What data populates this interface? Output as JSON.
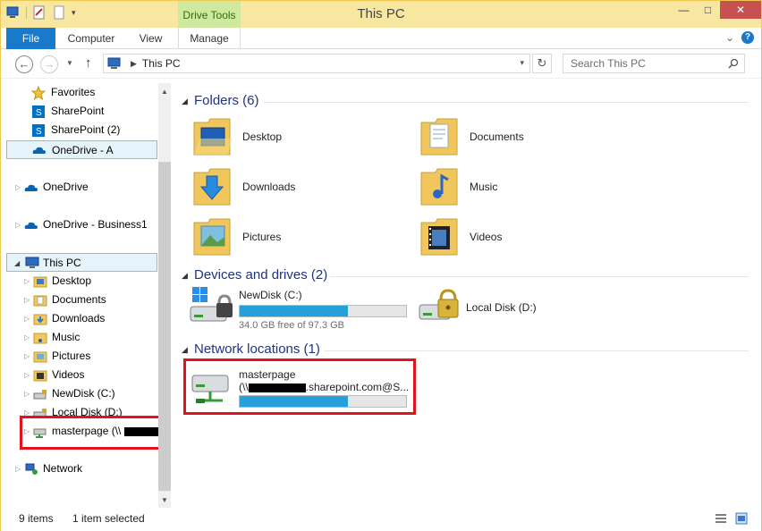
{
  "window": {
    "title": "This PC",
    "context_tab_label": "Drive Tools",
    "buttons": {
      "minimize": "—",
      "maximize": "□",
      "close": "✕"
    }
  },
  "ribbon": {
    "tabs": [
      {
        "label": "File"
      },
      {
        "label": "Computer"
      },
      {
        "label": "View"
      },
      {
        "label": "Manage"
      }
    ],
    "help_label": "?",
    "collapse_glyph": "⌄"
  },
  "address_bar": {
    "path": "This PC",
    "search_placeholder": "Search This PC",
    "back_glyph": "←",
    "forward_glyph": "→",
    "up_glyph": "↑",
    "refresh_glyph": "↻"
  },
  "nav_pane": {
    "items": [
      {
        "label": "Favorites",
        "icon": "star-icon"
      },
      {
        "label": "SharePoint",
        "icon": "sharepoint-icon"
      },
      {
        "label": "SharePoint (2)",
        "icon": "sharepoint-icon"
      },
      {
        "label": "OneDrive - A",
        "icon": "onedrive-icon"
      },
      {
        "label": "OneDrive",
        "icon": "onedrive-icon"
      },
      {
        "label": "OneDrive - Business1",
        "icon": "onedrive-icon"
      },
      {
        "label": "This PC",
        "icon": "computer-icon"
      },
      {
        "label": "Desktop",
        "icon": "folder-icon"
      },
      {
        "label": "Documents",
        "icon": "folder-icon"
      },
      {
        "label": "Downloads",
        "icon": "folder-icon"
      },
      {
        "label": "Music",
        "icon": "folder-icon"
      },
      {
        "label": "Pictures",
        "icon": "folder-icon"
      },
      {
        "label": "Videos",
        "icon": "folder-icon"
      },
      {
        "label": "NewDisk (C:)",
        "icon": "drive-icon"
      },
      {
        "label": "Local Disk (D:)",
        "icon": "drive-icon"
      },
      {
        "label": "masterpage (\\\\",
        "icon": "network-drive-icon"
      },
      {
        "label": "Network",
        "icon": "network-icon"
      }
    ]
  },
  "content": {
    "groups": {
      "folders": "Folders (6)",
      "devices": "Devices and drives (2)",
      "network": "Network locations (1)"
    },
    "folders": [
      {
        "label": "Desktop"
      },
      {
        "label": "Documents"
      },
      {
        "label": "Downloads"
      },
      {
        "label": "Music"
      },
      {
        "label": "Pictures"
      },
      {
        "label": "Videos"
      }
    ],
    "drives": [
      {
        "label": "NewDisk (C:)",
        "free": "34.0 GB free of 97.3 GB",
        "used_fraction": 0.65
      },
      {
        "label": "Local Disk (D:)"
      }
    ],
    "network_locations": [
      {
        "label": "masterpage",
        "path_prefix": "(\\\\",
        "path_suffix": ".sharepoint.com@S...",
        "used_fraction": 0.65
      }
    ]
  },
  "status_bar": {
    "item_count": "9 items",
    "selection": "1 item selected"
  },
  "colors": {
    "accent": "#1979ca",
    "selection_bg": "#e5f3fb",
    "selection_border": "#7fc1e8",
    "progress": "#26a0da",
    "highlight_box": "#e0131e",
    "group_heading": "#1e3287"
  }
}
